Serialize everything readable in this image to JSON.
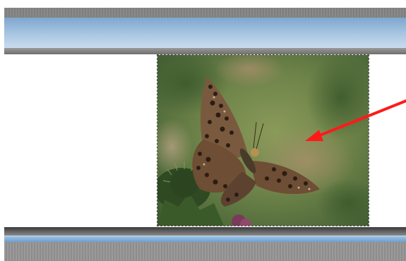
{
  "window": {
    "title": ""
  },
  "image": {
    "subject": "butterfly-photo"
  },
  "annotation": {
    "arrow_color": "#ff1a1a"
  },
  "colors": {
    "header_blue": "#a9c6e2",
    "accent_blue": "#6e9fcc",
    "bar_gray": "#7e7e7e"
  }
}
